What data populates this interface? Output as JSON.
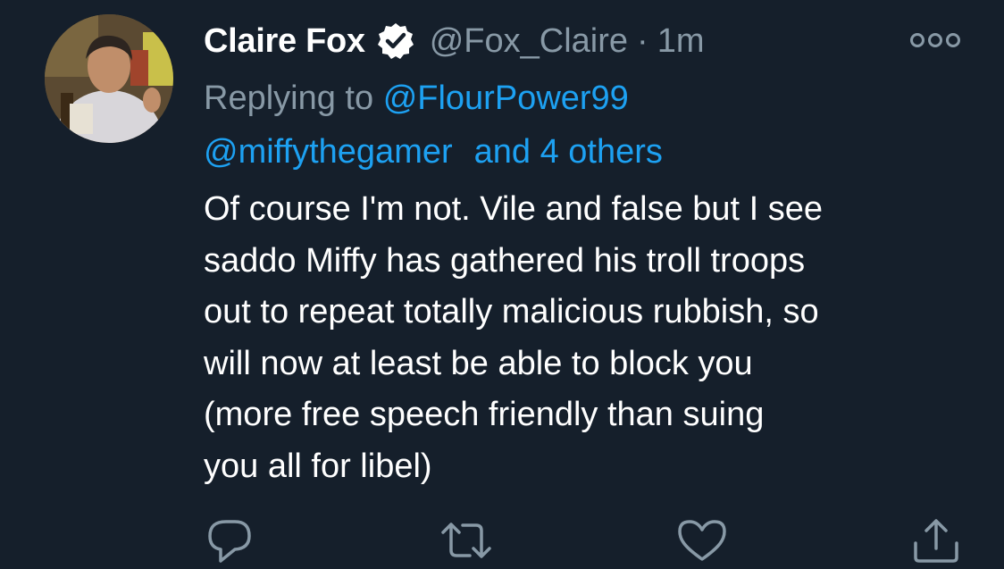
{
  "author": {
    "display_name": "Claire Fox",
    "handle": "@Fox_Claire",
    "separator": "·",
    "time": "1m",
    "verified": true
  },
  "reply_context": {
    "prefix": "Replying to",
    "primary_mention": "@FlourPower99",
    "secondary_mention": "@miffythegamer",
    "others": "and 4 others"
  },
  "tweet_text_lines": [
    "Of course I'm not. Vile and false but I see",
    "saddo Miffy has gathered his troll troops",
    "out to repeat totally malicious rubbish, so",
    "will now at least be able to block you",
    "(more free speech friendly than suing",
    "you all for libel)"
  ],
  "actions": {
    "reply_icon": "reply-icon",
    "retweet_icon": "retweet-icon",
    "like_icon": "like-icon",
    "share_icon": "share-icon"
  },
  "colors": {
    "background": "#151f2b",
    "text": "#ffffff",
    "muted": "#8899a6",
    "link": "#1da1f2"
  }
}
